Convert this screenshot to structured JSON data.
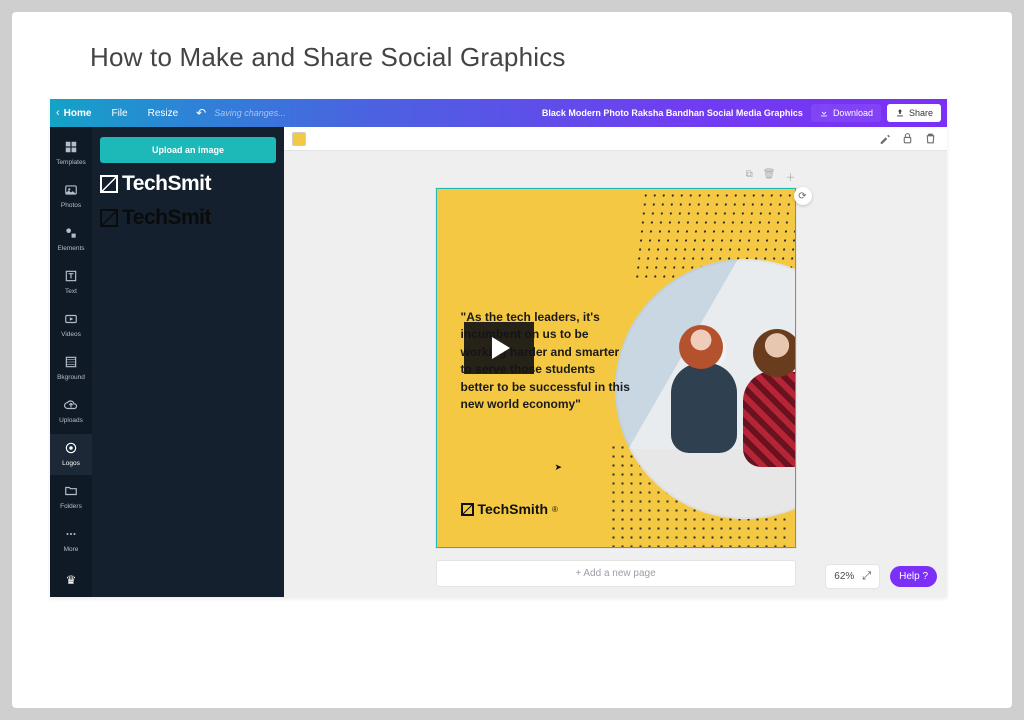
{
  "page_heading": "How to Make and Share Social Graphics",
  "topbar": {
    "home": "Home",
    "file": "File",
    "resize": "Resize",
    "saving": "Saving changes...",
    "doc_title": "Black Modern Photo Raksha Bandhan Social Media Graphics",
    "download": "Download",
    "share": "Share"
  },
  "rail": {
    "items": [
      {
        "id": "templates",
        "label": "Templates"
      },
      {
        "id": "photos",
        "label": "Photos"
      },
      {
        "id": "elements",
        "label": "Elements"
      },
      {
        "id": "text",
        "label": "Text"
      },
      {
        "id": "videos",
        "label": "Videos"
      },
      {
        "id": "bkground",
        "label": "Bkground"
      },
      {
        "id": "uploads",
        "label": "Uploads"
      },
      {
        "id": "logos",
        "label": "Logos"
      },
      {
        "id": "folders",
        "label": "Folders"
      },
      {
        "id": "more",
        "label": "More"
      }
    ]
  },
  "panel": {
    "upload_label": "Upload an image",
    "logo_text": "TechSmit"
  },
  "canvas": {
    "quote": "\"As the tech leaders, it's incumbent on us to be working harder and smarter to serve those students better to be successful in this new world economy\"",
    "brand": "TechSmith",
    "add_page": "+ Add a new page"
  },
  "status": {
    "zoom": "62%",
    "help": "Help ?"
  }
}
